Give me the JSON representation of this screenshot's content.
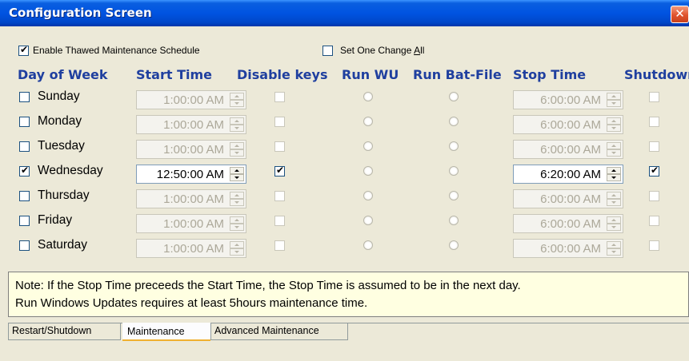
{
  "window": {
    "title": "Configuration Screen",
    "close_glyph": "✕"
  },
  "options": {
    "enable_thawed": {
      "label": "Enable Thawed Maintenance Schedule",
      "checked": true
    },
    "set_one_change_all": {
      "label_prefix": "Set One Change ",
      "label_accel": "A",
      "label_suffix": "ll",
      "checked": false
    }
  },
  "columns": {
    "day": "Day of Week",
    "start": "Start Time",
    "disable": "Disable keys",
    "run_wu": "Run WU",
    "run_bat": "Run Bat-File",
    "stop": "Stop Time",
    "shutdown": "Shutdown"
  },
  "rows": [
    {
      "day": "Sunday",
      "enabled": false,
      "start": "1:00:00 AM",
      "disable_keys": false,
      "stop": "6:00:00 AM",
      "shutdown": false
    },
    {
      "day": "Monday",
      "enabled": false,
      "start": "1:00:00 AM",
      "disable_keys": false,
      "stop": "6:00:00 AM",
      "shutdown": false
    },
    {
      "day": "Tuesday",
      "enabled": false,
      "start": "1:00:00 AM",
      "disable_keys": false,
      "stop": "6:00:00 AM",
      "shutdown": false
    },
    {
      "day": "Wednesday",
      "enabled": true,
      "start": "12:50:00 AM",
      "disable_keys": true,
      "stop": "6:20:00 AM",
      "shutdown": true
    },
    {
      "day": "Thursday",
      "enabled": false,
      "start": "1:00:00 AM",
      "disable_keys": false,
      "stop": "6:00:00 AM",
      "shutdown": false
    },
    {
      "day": "Friday",
      "enabled": false,
      "start": "1:00:00 AM",
      "disable_keys": false,
      "stop": "6:00:00 AM",
      "shutdown": false
    },
    {
      "day": "Saturday",
      "enabled": false,
      "start": "1:00:00 AM",
      "disable_keys": false,
      "stop": "6:00:00 AM",
      "shutdown": false
    }
  ],
  "note": {
    "line1": "Note: If the Stop Time preceeds the Start Time, the Stop Time is assumed to be in the next day.",
    "line2": "Run Windows Updates requires at least 5hours maintenance time."
  },
  "tabs": [
    {
      "label": "Restart/Shutdown",
      "active": false
    },
    {
      "label": "Maintenance",
      "active": true
    },
    {
      "label": "Advanced Maintenance",
      "active": false
    }
  ],
  "colors": {
    "titlebar": "#0053e1",
    "header_text": "#1f3f9f",
    "checkmark": "#21a121",
    "note_bg": "#ffffe1"
  }
}
